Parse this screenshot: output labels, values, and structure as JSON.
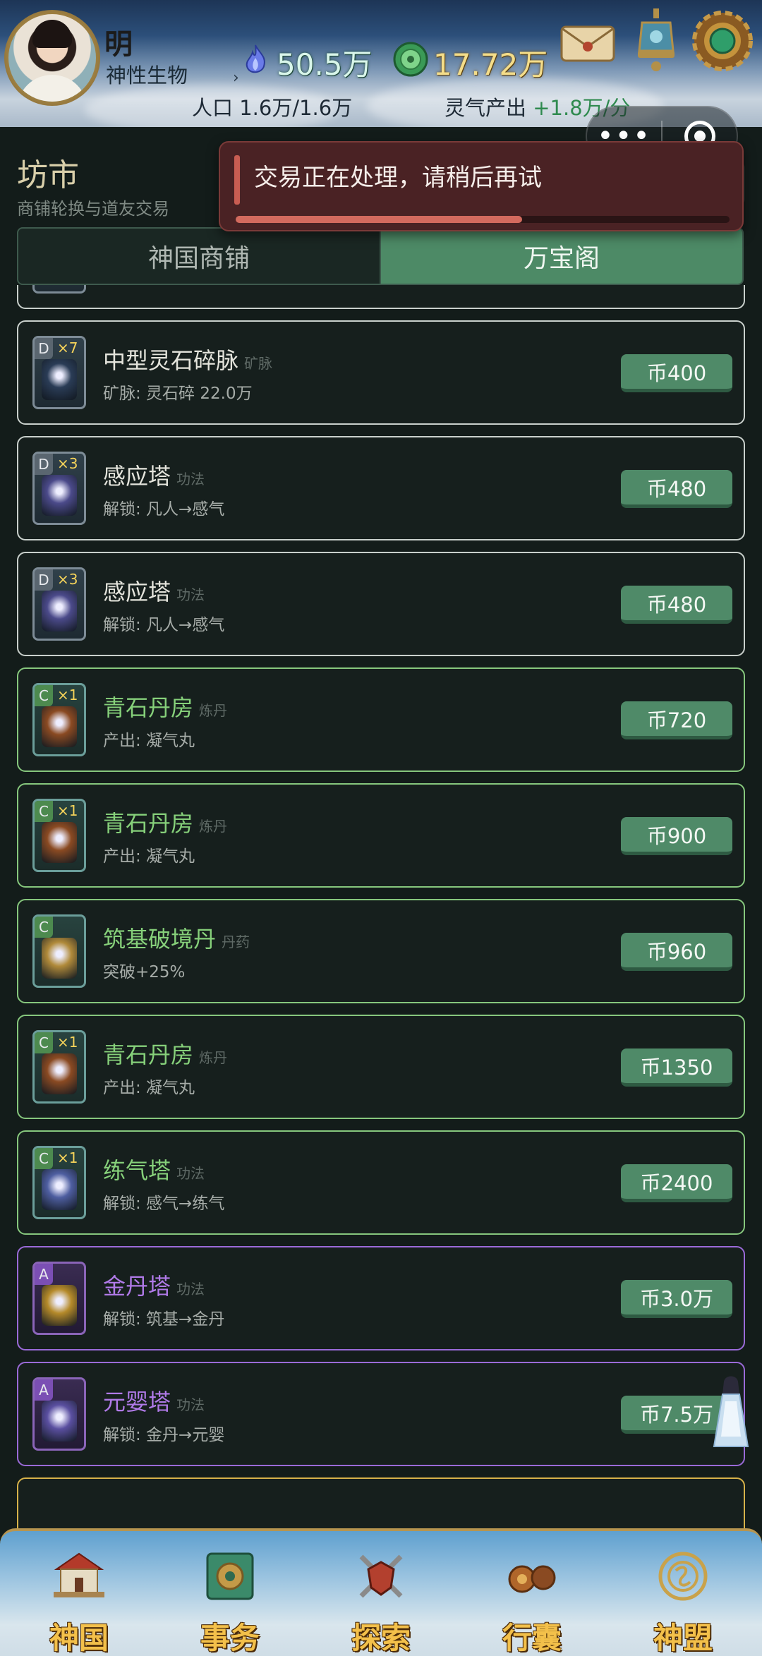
{
  "player": {
    "name": "明",
    "title": "神性生物",
    "chevron": "›"
  },
  "resources": {
    "essence": "50.5万",
    "jade": "17.72万",
    "population": "人口 1.6万/1.6万",
    "qi_label": "灵气产出",
    "qi_rate": "+1.8万/分"
  },
  "capsule": {
    "more": "•••"
  },
  "section": {
    "title": "坊市",
    "subtitle": "商铺轮换与道友交易"
  },
  "tabs": [
    {
      "label": "神国商铺",
      "active": false
    },
    {
      "label": "万宝阁",
      "active": true
    }
  ],
  "toast": {
    "message": "交易正在处理，请稍后再试",
    "progress": 0.58
  },
  "items": [
    {
      "rarity": "D",
      "qty": "×7",
      "name": "中型灵石碎脉",
      "tag": "矿脉",
      "desc": "矿脉: 灵石碎 22.0万",
      "price": "币400",
      "art": "#2a3c56"
    },
    {
      "rarity": "D",
      "qty": "×7",
      "name": "中型灵石碎脉",
      "tag": "矿脉",
      "desc": "矿脉: 灵石碎 22.0万",
      "price": "币400",
      "art": "#2a3c56"
    },
    {
      "rarity": "D",
      "qty": "×3",
      "name": "感应塔",
      "tag": "功法",
      "desc": "解锁: 凡人→感气",
      "price": "币480",
      "art": "#4b4a8a"
    },
    {
      "rarity": "D",
      "qty": "×3",
      "name": "感应塔",
      "tag": "功法",
      "desc": "解锁: 凡人→感气",
      "price": "币480",
      "art": "#4b4a8a"
    },
    {
      "rarity": "C",
      "qty": "×1",
      "name": "青石丹房",
      "tag": "炼丹",
      "desc": "产出: 凝气丸",
      "price": "币720",
      "art": "#8a4a22"
    },
    {
      "rarity": "C",
      "qty": "×1",
      "name": "青石丹房",
      "tag": "炼丹",
      "desc": "产出: 凝气丸",
      "price": "币900",
      "art": "#8a4a22"
    },
    {
      "rarity": "C",
      "qty": "",
      "name": "筑基破境丹",
      "tag": "丹药",
      "desc": "突破+25%",
      "price": "币960",
      "art": "#b08a3a"
    },
    {
      "rarity": "C",
      "qty": "×1",
      "name": "青石丹房",
      "tag": "炼丹",
      "desc": "产出: 凝气丸",
      "price": "币1350",
      "art": "#8a4a22"
    },
    {
      "rarity": "C",
      "qty": "×1",
      "name": "练气塔",
      "tag": "功法",
      "desc": "解锁: 感气→练气",
      "price": "币2400",
      "art": "#4e5ea0"
    },
    {
      "rarity": "A",
      "qty": "",
      "name": "金丹塔",
      "tag": "功法",
      "desc": "解锁: 筑基→金丹",
      "price": "币3.0万",
      "art": "#b58a2a"
    },
    {
      "rarity": "A",
      "qty": "",
      "name": "元婴塔",
      "tag": "功法",
      "desc": "解锁: 金丹→元婴",
      "price": "币7.5万",
      "art": "#5a4fa0"
    }
  ],
  "nav": [
    {
      "label": "神国",
      "icon": "palace-icon"
    },
    {
      "label": "事务",
      "icon": "jade-box-icon"
    },
    {
      "label": "探索",
      "icon": "crossed-swords-icon"
    },
    {
      "label": "行囊",
      "icon": "gourd-bag-icon"
    },
    {
      "label": "神盟",
      "icon": "alliance-emblem-icon"
    }
  ],
  "colors": {
    "accent_green": "#4d8a66",
    "rarity_c": "#86c77d",
    "rarity_a": "#9a6ad8",
    "rarity_s": "#d6b24a",
    "toast_bg": "#4a2224",
    "nav_label": "#f3c04a"
  }
}
